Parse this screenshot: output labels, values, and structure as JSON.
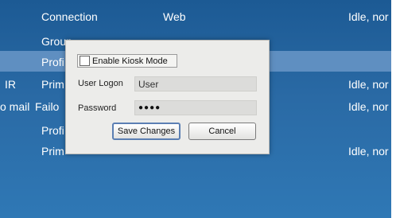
{
  "table": {
    "rows": [
      {
        "c1": "",
        "c2": "Connection",
        "c3": "Web",
        "c4": "Idle, nor"
      },
      {
        "c1": "",
        "c2": "Group",
        "c3": "",
        "c4": ""
      },
      {
        "c1": "",
        "c2": "Profi",
        "c3": "",
        "c4": ""
      },
      {
        "c1": "IR",
        "c2": "Prim",
        "c3": "",
        "c4": "Idle, nor"
      },
      {
        "c1": "o mail",
        "c2": "Failo",
        "c3": "",
        "c4": "Idle, nor"
      },
      {
        "c1": "",
        "c2": "Profi",
        "c3": "",
        "c4": ""
      },
      {
        "c1": "",
        "c2": "Prim",
        "c3": "",
        "c4": "Idle, nor"
      }
    ]
  },
  "dialog": {
    "kiosk_label": "Enable Kiosk Mode",
    "kiosk_checked": false,
    "user_logon_label": "User Logon",
    "user_logon_value": "User",
    "password_label": "Password",
    "password_value": "●●●●",
    "save_label": "Save Changes",
    "cancel_label": "Cancel"
  }
}
